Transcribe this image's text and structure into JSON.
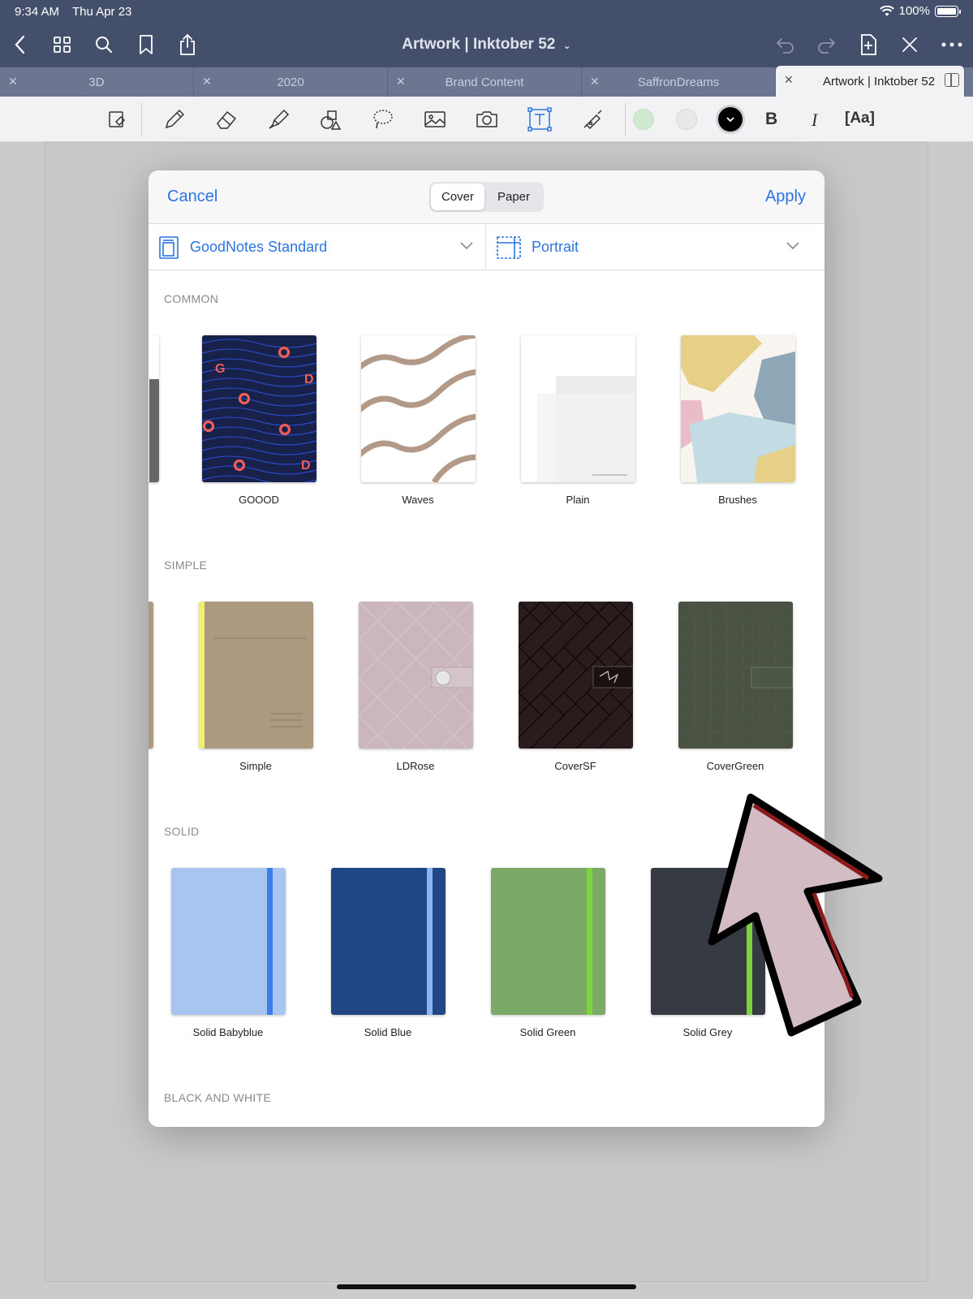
{
  "status": {
    "time": "9:34 AM",
    "date": "Thu Apr 23",
    "battery": "100%"
  },
  "nav": {
    "title": "Artwork",
    "subtitle": "| Inktober 52"
  },
  "tabs": [
    {
      "label": "3D",
      "active": false
    },
    {
      "label": "2020",
      "active": false
    },
    {
      "label": "Brand Content",
      "active": false
    },
    {
      "label": "SaffronDreams",
      "active": false
    },
    {
      "label": "Artwork  | Inktober 52",
      "active": true
    }
  ],
  "toolbar": {
    "colors": [
      "#cfe8cf",
      "#e8e8e8",
      "#000000"
    ],
    "bold": "B",
    "italic": "I",
    "text_style": "[Aa]"
  },
  "modal": {
    "cancel": "Cancel",
    "apply": "Apply",
    "segments": [
      "Cover",
      "Paper"
    ],
    "selected_segment": "Cover",
    "template_set": "GoodNotes Standard",
    "orientation": "Portrait",
    "sections": [
      {
        "title": "COMMON",
        "items": [
          "GOOOD",
          "Waves",
          "Plain",
          "Brushes"
        ]
      },
      {
        "title": "SIMPLE",
        "items": [
          "Simple",
          "LDRose",
          "CoverSF",
          "CoverGreen"
        ]
      },
      {
        "title": "SOLID",
        "items": [
          "Solid Babyblue",
          "Solid Blue",
          "Solid Green",
          "Solid Grey"
        ]
      },
      {
        "title": "BLACK AND WHITE",
        "items": []
      }
    ]
  },
  "colors": {
    "accent": "#2b74e2",
    "chrome": "#444f6b",
    "tabbar": "#6c7690"
  }
}
